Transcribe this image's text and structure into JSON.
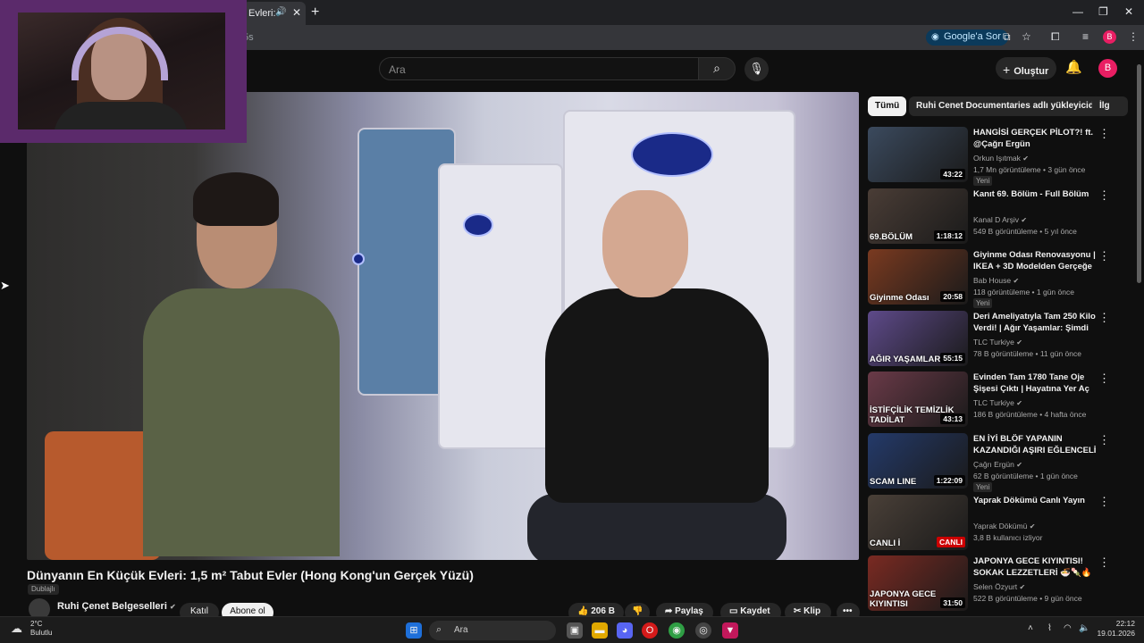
{
  "browser": {
    "tab_title": "Evleri:",
    "address_fragment": "5s",
    "google_button": "Google'a Sor",
    "profile_initial": "B"
  },
  "youtube": {
    "search_placeholder": "Ara",
    "create_label": "Oluştur",
    "avatar_initial": "B"
  },
  "video": {
    "title": "Dünyanın En Küçük Evleri: 1,5 m² Tabut Evler (Hong Kong'un Gerçek Yüzü)",
    "dub_badge": "Dublajlı",
    "channel": "Ruhi Çenet Belgeselleri",
    "join_label": "Katıl",
    "subscribe_label": "Abone ol",
    "actions": {
      "likes": "206 B",
      "share": "Paylaş",
      "save": "Kaydet",
      "clip": "Klip"
    }
  },
  "chips": [
    {
      "label": "Tümü",
      "active": true
    },
    {
      "label": "Ruhi Cenet Documentaries adlı yükleyiciden",
      "active": false
    },
    {
      "label": "İlg",
      "active": false
    }
  ],
  "recommendations": [
    {
      "title": "HANGİSİ GERÇEK PİLOT?! ft. @Çağrı Ergün",
      "channel": "Orkun Işıtmak",
      "views": "1,7 Mn görüntüleme",
      "age": "3 gün önce",
      "badge": "Yeni",
      "duration": "43:22",
      "thumb_label": "",
      "thumb_color": "#3b4a5e"
    },
    {
      "title": "Kanıt 69. Bölüm - Full Bölüm",
      "channel": "Kanal D Arşiv",
      "views": "549 B görüntüleme",
      "age": "5 yıl önce",
      "badge": "",
      "duration": "1:18:12",
      "thumb_label": "69.BÖLÜM",
      "thumb_color": "#4a3d36"
    },
    {
      "title": "Giyinme Odası Renovasyonu | IKEA + 3D Modelden Gerçeğe",
      "channel": "Bab House",
      "views": "118 görüntüleme",
      "age": "1 gün önce",
      "badge": "Yeni",
      "duration": "20:58",
      "thumb_label": "Giyinme Odası",
      "thumb_color": "#7a3a20"
    },
    {
      "title": "Deri Ameliyatıyla Tam 250 Kilo Verdi! | Ağır Yaşamlar: Şimdi N...",
      "channel": "TLC Turkiye",
      "views": "78 B görüntüleme",
      "age": "11 gün önce",
      "badge": "",
      "duration": "55:15",
      "thumb_label": "AĞIR YAŞAMLAR",
      "thumb_color": "#5e4a8a"
    },
    {
      "title": "Evinden Tam 1780 Tane Oje Şişesi Çıktı | Hayatına Yer Aç 2...",
      "channel": "TLC Turkiye",
      "views": "186 B görüntüleme",
      "age": "4 hafta önce",
      "badge": "",
      "duration": "43:13",
      "thumb_label": "İSTİFÇİLİK TEMİZLİK TADİLAT",
      "thumb_color": "#6a3a48"
    },
    {
      "title": "EN İYİ BLÖF YAPANIN KAZANDIĞI AŞIRI EĞLENCELİ ...",
      "channel": "Çağrı Ergün",
      "views": "62 B görüntüleme",
      "age": "1 gün önce",
      "badge": "Yeni",
      "duration": "1:22:09",
      "thumb_label": "SCAM LINE",
      "thumb_color": "#243a6a"
    },
    {
      "title": "Yaprak Dökümü Canlı Yayın",
      "channel": "Yaprak Dökümü",
      "views": "3,8 B kullanıcı izliyor",
      "age": "",
      "badge": "",
      "duration": "",
      "live": "CANLI",
      "thumb_label": "CANLI İ",
      "thumb_color": "#4a4038"
    },
    {
      "title": "JAPONYA GECE KIYINTISI! SOKAK LEZZETLERİ 🍜🍡🔥",
      "channel": "Selen Özyurt",
      "views": "522 B görüntüleme",
      "age": "9 gün önce",
      "badge": "",
      "duration": "31:50",
      "thumb_label": "JAPONYA GECE KIYINTISI",
      "thumb_color": "#7a2a22"
    }
  ],
  "taskbar": {
    "temp": "2°C",
    "weather": "Bulutlu",
    "search": "Ara",
    "time": "22:12",
    "date": "19.01.2026"
  }
}
